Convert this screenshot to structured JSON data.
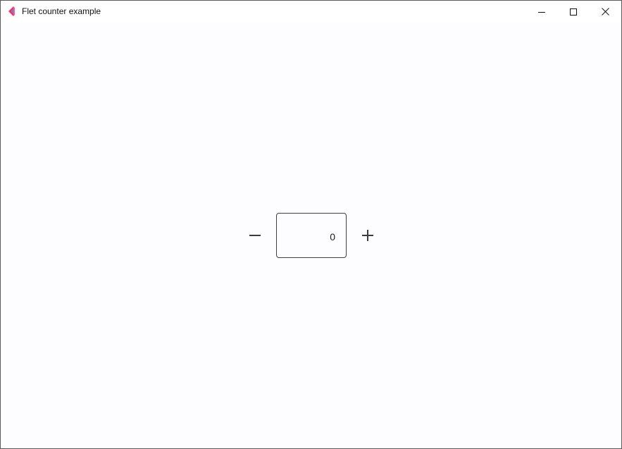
{
  "window": {
    "title": "Flet counter example",
    "icon": "flet-logo-icon",
    "controls": {
      "minimize": "minimize-icon",
      "maximize": "maximize-icon",
      "close": "close-icon"
    }
  },
  "counter": {
    "decrement_icon": "minus-icon",
    "increment_icon": "plus-icon",
    "value": "0"
  },
  "colors": {
    "background": "#fdfcff",
    "titlebar": "#ffffff",
    "icon_pink": "#e8336d",
    "icon_blue": "#3f8fe8",
    "field_border": "#3f3f3f",
    "text": "#1b1b1f"
  }
}
